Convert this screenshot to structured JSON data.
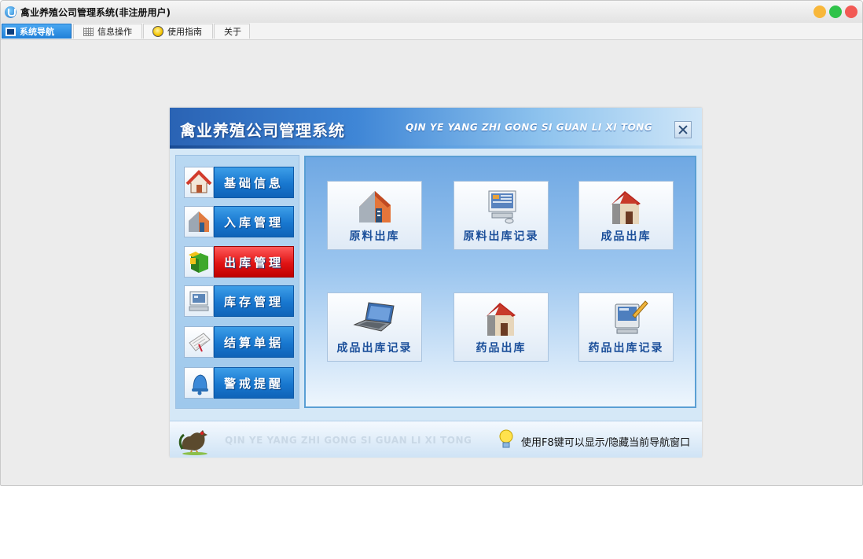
{
  "window": {
    "title": "禽业养殖公司管理系统(非注册用户)"
  },
  "tabs": [
    {
      "label": "系统导航",
      "icon": "monitor-icon",
      "active": true
    },
    {
      "label": "信息操作",
      "icon": "grid-icon",
      "active": false
    },
    {
      "label": "使用指南",
      "icon": "bulb-icon",
      "active": false
    },
    {
      "label": "关于",
      "icon": "",
      "active": false
    }
  ],
  "dialog": {
    "title": "禽业养殖公司管理系统",
    "subtitle": "QIN YE YANG ZHI GONG SI GUAN LI XI TONG",
    "sidebar": [
      {
        "label": "基础信息",
        "icon": "home-icon",
        "active": false
      },
      {
        "label": "入库管理",
        "icon": "warehouse-icon",
        "active": false
      },
      {
        "label": "出库管理",
        "icon": "package-icon",
        "active": true
      },
      {
        "label": "库存管理",
        "icon": "computer-icon",
        "active": false
      },
      {
        "label": "结算单据",
        "icon": "document-icon",
        "active": false
      },
      {
        "label": "警戒提醒",
        "icon": "bell-icon",
        "active": false
      }
    ],
    "tiles": [
      {
        "label": "原料出库",
        "icon": "warehouse-icon"
      },
      {
        "label": "原料出库记录",
        "icon": "computer-icon"
      },
      {
        "label": "成品出库",
        "icon": "house-icon"
      },
      {
        "label": "成品出库记录",
        "icon": "laptop-icon"
      },
      {
        "label": "药品出库",
        "icon": "house-icon"
      },
      {
        "label": "药品出库记录",
        "icon": "monitor-pen-icon"
      }
    ],
    "footer": {
      "watermark": "QIN YE YANG ZHI GONG SI GUAN LI XI TONG",
      "hint": "使用F8键可以显示/隐藏当前导航窗口"
    }
  },
  "colors": {
    "accent_blue": "#1877cf",
    "active_red": "#e01414",
    "tile_text": "#1b4f9a"
  }
}
